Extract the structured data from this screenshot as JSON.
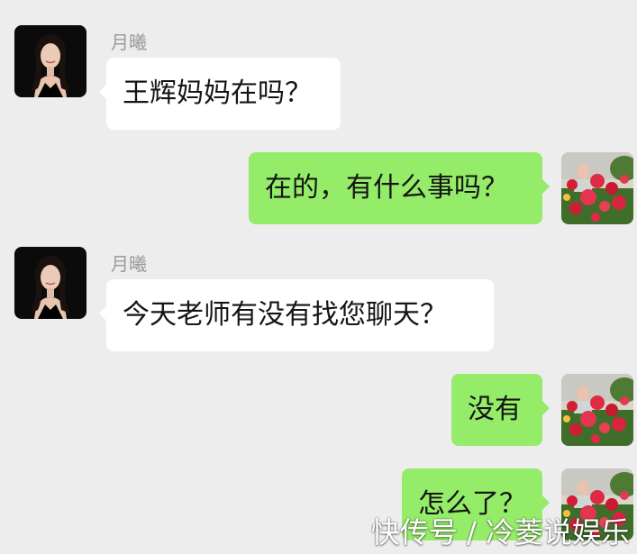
{
  "colors": {
    "background": "#ededed",
    "incoming_bubble": "#ffffff",
    "outgoing_bubble": "#95ec69",
    "sender_name": "#9a9a9a"
  },
  "messages": [
    {
      "direction": "incoming",
      "sender": "月曦",
      "avatar": "woman-portrait-avatar",
      "text": "王辉妈妈在吗？"
    },
    {
      "direction": "outgoing",
      "avatar": "rose-flowers-avatar",
      "text": "在的，有什么事吗？"
    },
    {
      "direction": "incoming",
      "sender": "月曦",
      "avatar": "woman-portrait-avatar",
      "text": "今天老师有没有找您聊天？"
    },
    {
      "direction": "outgoing",
      "avatar": "rose-flowers-avatar",
      "text": "没有"
    },
    {
      "direction": "outgoing",
      "avatar": "rose-flowers-avatar",
      "text": "怎么了？"
    }
  ],
  "watermark": "快传号 / 冷菱说娱乐"
}
